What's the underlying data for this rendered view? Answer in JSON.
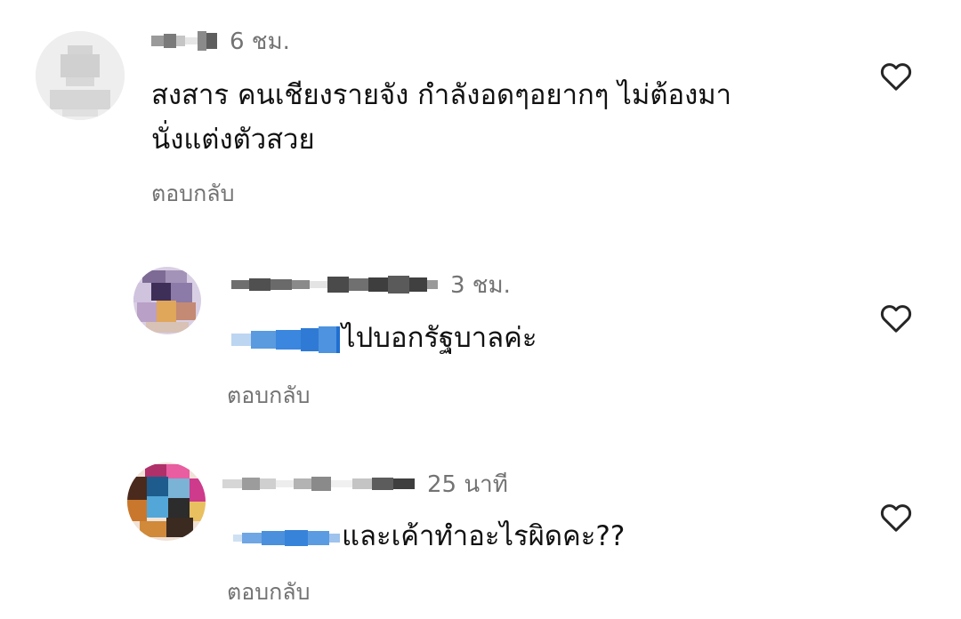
{
  "comments": [
    {
      "time": "6 ชม.",
      "text_line1": "สงสาร คนเชียงรายจัง กำลังอดๆอยากๆ ไม่ต้องมา",
      "text_line2": "นั่งแต่งตัวสวย",
      "reply_label": "ตอบกลับ"
    },
    {
      "time": "3 ชม.",
      "text": "ไปบอกรัฐบาลค่ะ",
      "reply_label": "ตอบกลับ"
    },
    {
      "time": "25 นาที",
      "text": "และเค้าทำอะไรผิดคะ??",
      "reply_label": "ตอบกลับ"
    }
  ],
  "icons": {
    "like": "heart-outline-icon"
  },
  "colors": {
    "secondary_text": "#737373",
    "mention_blue": "#3d8fe0"
  }
}
